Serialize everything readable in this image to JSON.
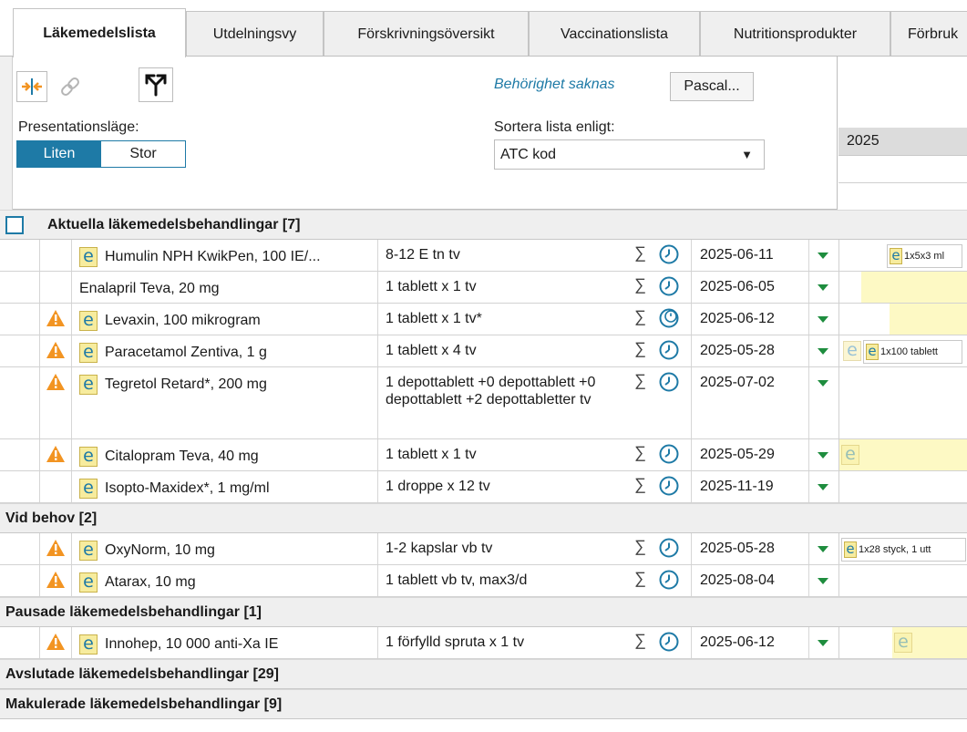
{
  "tabs": [
    {
      "label": "Läkemedelslista",
      "active": true
    },
    {
      "label": "Utdelningsvy"
    },
    {
      "label": "Förskrivningsöversikt"
    },
    {
      "label": "Vaccinationslista"
    },
    {
      "label": "Nutritionsprodukter"
    },
    {
      "label": "Förbruk"
    }
  ],
  "panel": {
    "presentation_label": "Presentationsläge:",
    "seg_small": "Liten",
    "seg_large": "Stor",
    "permission_message": "Behörighet saknas",
    "pascal_button": "Pascal...",
    "sort_label": "Sortera lista enligt:",
    "sort_value": "ATC kod"
  },
  "timeline": {
    "year": "2025"
  },
  "groups": [
    {
      "label": "Aktuella läkemedelsbehandlingar [7]",
      "rows": [
        {
          "name": "Humulin NPH KwikPen, 100 IE/...",
          "dose": "8-12 E tn tv",
          "date": "2025-06-11",
          "warn": false,
          "eicon": true,
          "tl_box": "1x5x3 ml"
        },
        {
          "name": "Enalapril Teva, 20 mg",
          "dose": "1 tablett x 1 tv",
          "date": "2025-06-05",
          "warn": false,
          "eicon": false
        },
        {
          "name": "Levaxin, 100 mikrogram",
          "dose": "1 tablett x 1 tv*",
          "date": "2025-06-12",
          "warn": true,
          "eicon": true
        },
        {
          "name": "Paracetamol Zentiva, 1 g",
          "dose": "1 tablett x 4 tv",
          "date": "2025-05-28",
          "warn": true,
          "eicon": true,
          "tl_box": "1x100 tablett"
        },
        {
          "name": "Tegretol Retard*, 200 mg",
          "dose": "1 depottablett +0 depottablett +0 depottablett +2 depottabletter tv",
          "date": "2025-07-02",
          "warn": true,
          "eicon": true
        },
        {
          "name": "Citalopram Teva, 40 mg",
          "dose": "1 tablett x 1 tv",
          "date": "2025-05-29",
          "warn": true,
          "eicon": true
        },
        {
          "name": "Isopto-Maxidex*, 1 mg/ml",
          "dose": "1 droppe x 12 tv",
          "date": "2025-11-19",
          "warn": false,
          "eicon": true
        }
      ]
    },
    {
      "label": "Vid behov [2]",
      "rows": [
        {
          "name": "OxyNorm, 10 mg",
          "dose": "1-2 kapslar vb tv",
          "date": "2025-05-28",
          "warn": true,
          "eicon": true,
          "tl_box": "1x28 styck, 1 utt"
        },
        {
          "name": "Atarax, 10 mg",
          "dose": "1 tablett vb tv, max3/d",
          "date": "2025-08-04",
          "warn": true,
          "eicon": true
        }
      ]
    },
    {
      "label": "Pausade läkemedelsbehandlingar [1]",
      "rows": [
        {
          "name": "Innohep, 10 000 anti-Xa IE",
          "dose": "1 förfylld spruta x 1 tv",
          "date": "2025-06-12",
          "warn": true,
          "eicon": true
        }
      ]
    },
    {
      "label": "Avslutade läkemedelsbehandlingar [29]",
      "rows": []
    },
    {
      "label": "Makulerade läkemedelsbehandlingar [9]",
      "rows": []
    }
  ],
  "symbols": {
    "sigma": "∑",
    "eicon": "e",
    "caret": "▼"
  },
  "colors": {
    "accent": "#1e7aa6",
    "warning": "#f29422",
    "dropdown_arrow": "#1e8d3e",
    "timeline_bar": "#fdf9c4"
  }
}
